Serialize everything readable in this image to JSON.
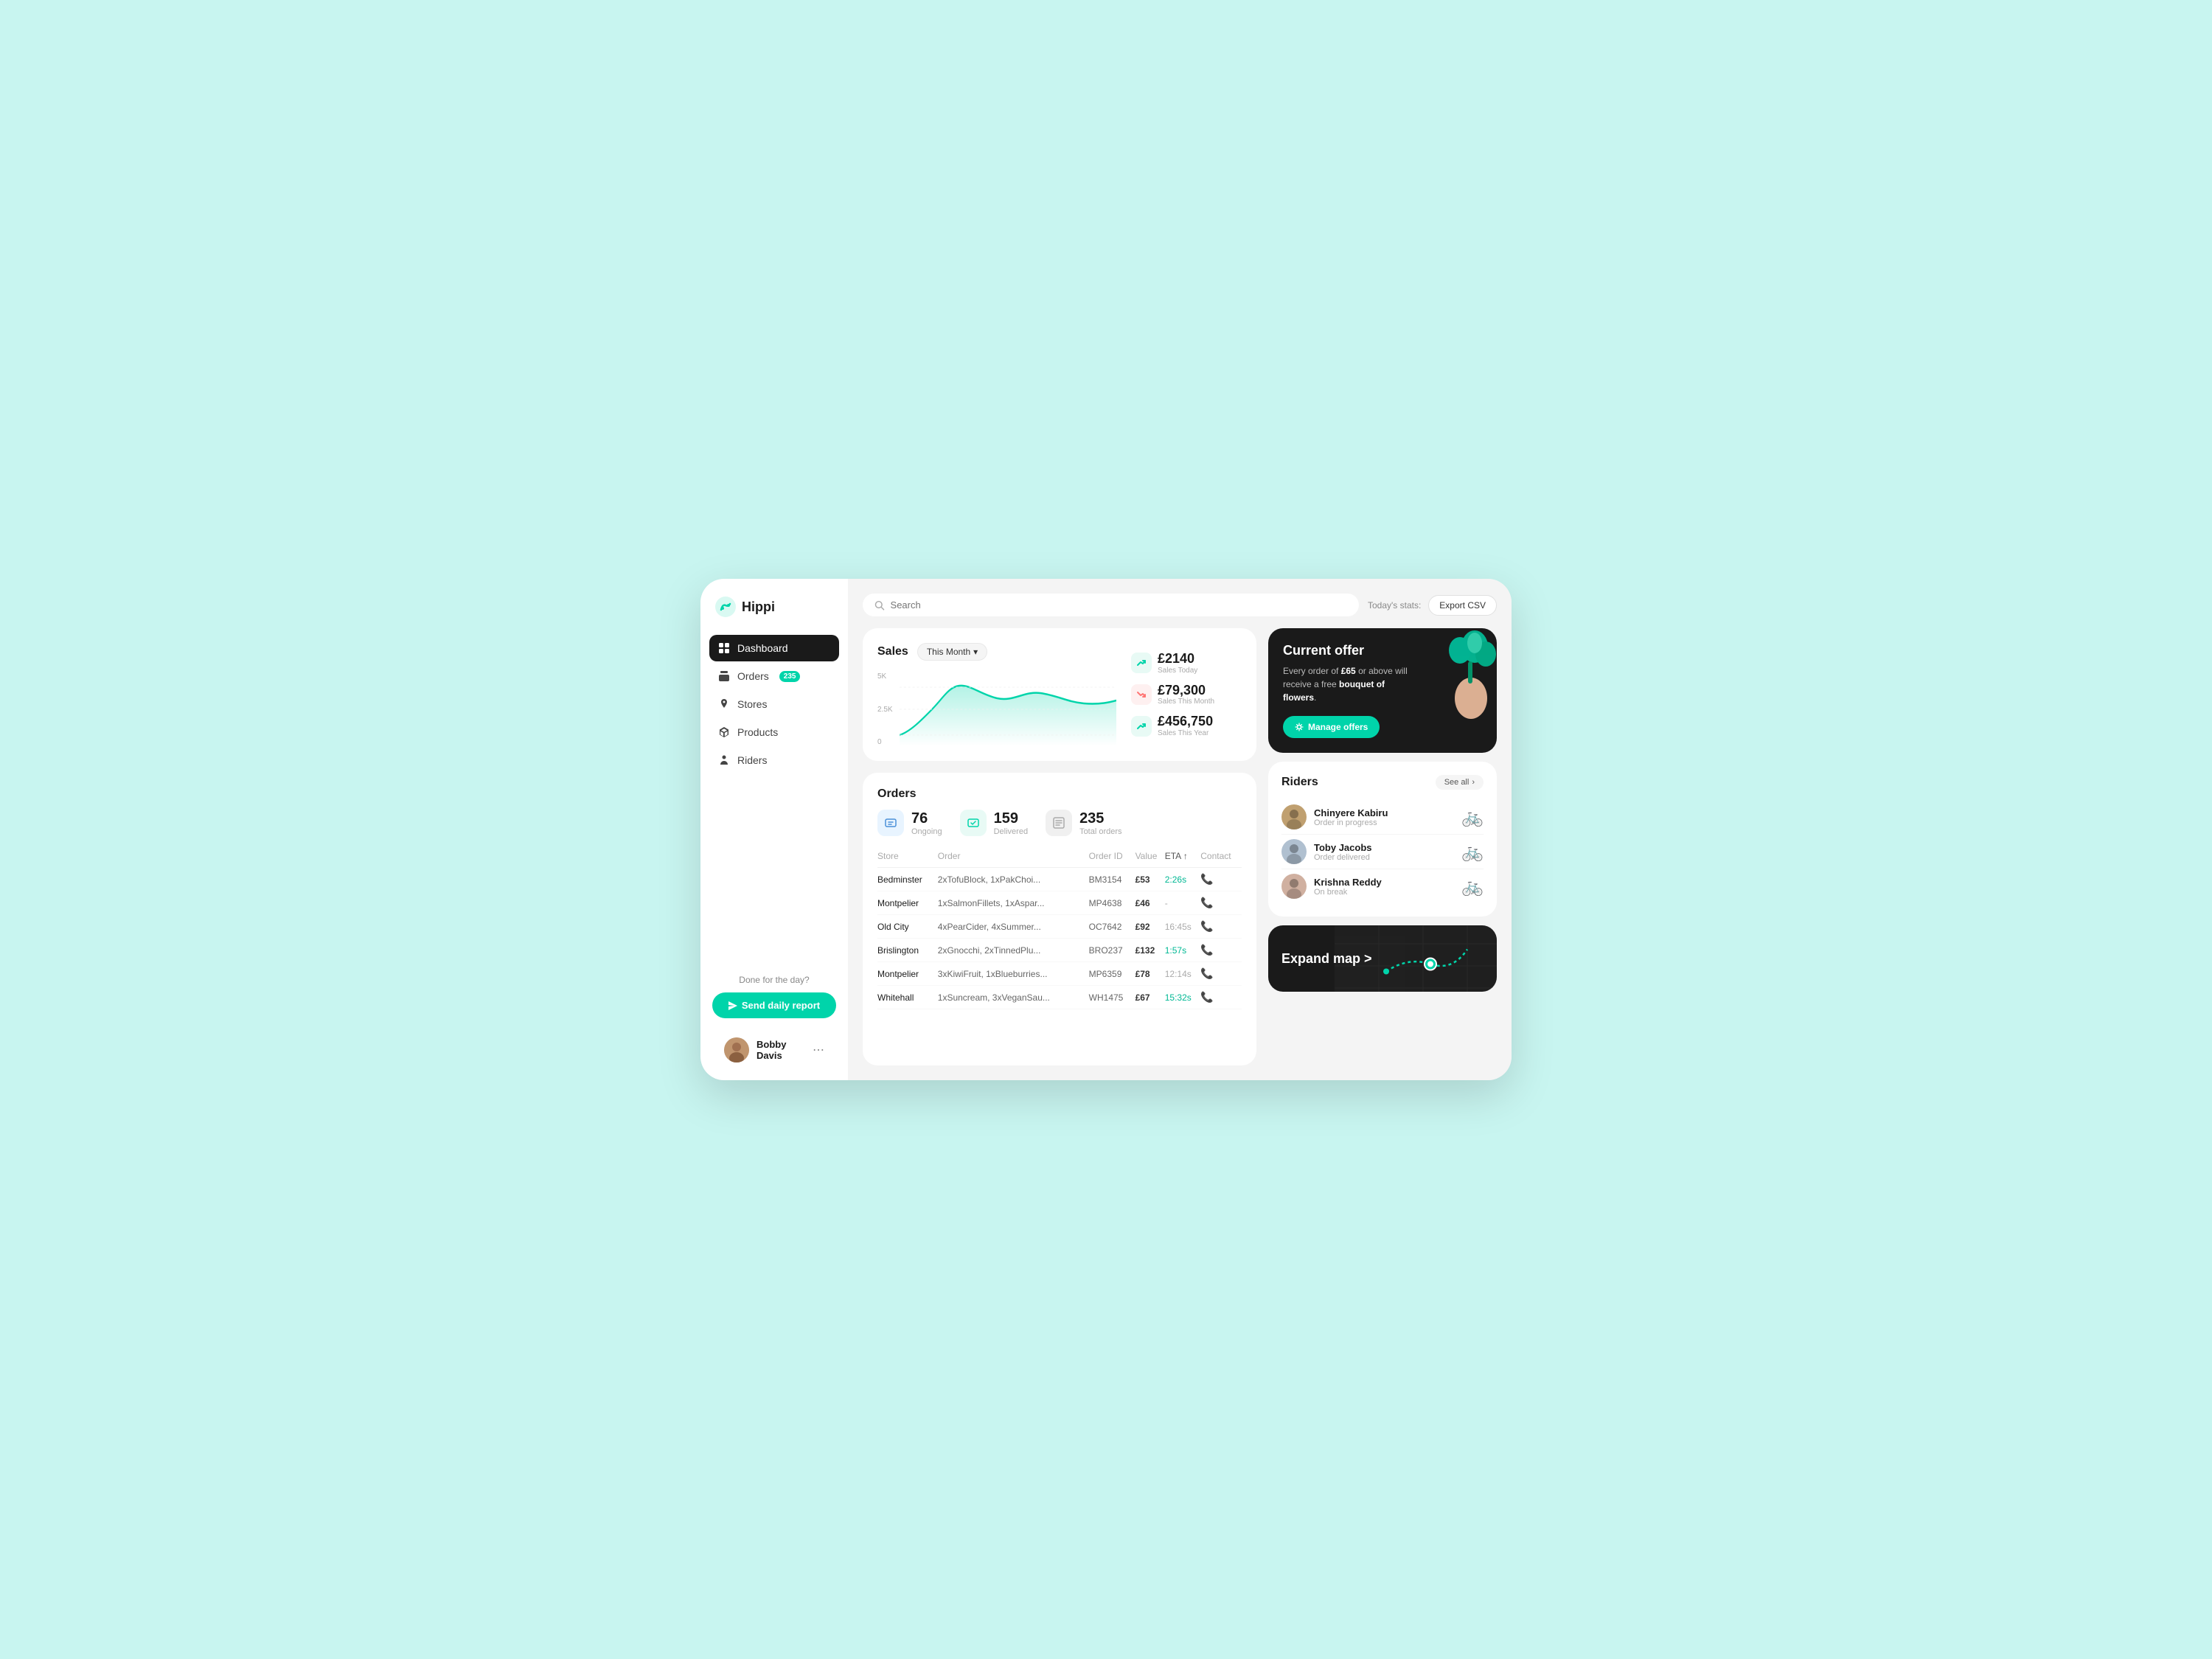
{
  "app": {
    "name": "Hippi"
  },
  "sidebar": {
    "nav_items": [
      {
        "id": "dashboard",
        "label": "Dashboard",
        "icon": "grid",
        "active": true,
        "badge": null
      },
      {
        "id": "orders",
        "label": "Orders",
        "icon": "bag",
        "active": false,
        "badge": "235"
      },
      {
        "id": "stores",
        "label": "Stores",
        "icon": "location",
        "active": false,
        "badge": null
      },
      {
        "id": "products",
        "label": "Products",
        "icon": "leaf",
        "active": false,
        "badge": null
      },
      {
        "id": "riders",
        "label": "Riders",
        "icon": "person",
        "active": false,
        "badge": null
      }
    ],
    "done_text": "Done for the day?",
    "send_report_label": "Send daily report",
    "user": {
      "name": "Bobby Davis"
    }
  },
  "header": {
    "search_placeholder": "Search",
    "stats_label": "Today's stats:",
    "export_btn": "Export CSV"
  },
  "sales": {
    "title": "Sales",
    "period": "This Month",
    "metrics": [
      {
        "value": "£2140",
        "label": "Sales Today",
        "trend": "up"
      },
      {
        "value": "£79,300",
        "label": "Sales This Month",
        "trend": "down"
      },
      {
        "value": "£456,750",
        "label": "Sales This Year",
        "trend": "up"
      }
    ],
    "chart_y_labels": [
      "5K",
      "2.5K",
      "0"
    ],
    "chart_data": [
      10,
      20,
      60,
      80,
      55,
      70,
      45,
      65,
      60,
      55,
      65
    ]
  },
  "orders": {
    "title": "Orders",
    "stats": [
      {
        "num": "76",
        "label": "Ongoing",
        "type": "blue"
      },
      {
        "num": "159",
        "label": "Delivered",
        "type": "green"
      },
      {
        "num": "235",
        "label": "Total orders",
        "type": "gray"
      }
    ],
    "table_headers": [
      "Store",
      "Order",
      "Order ID",
      "Value",
      "ETA",
      "Contact"
    ],
    "rows": [
      {
        "store": "Bedminster",
        "order": "2xTofuBlock, 1xPakChoi...",
        "order_id": "BM3154",
        "value": "£53",
        "eta": "2:26s",
        "eta_type": "active",
        "contact": "active"
      },
      {
        "store": "Montpelier",
        "order": "1xSalmonFillets, 1xAspar...",
        "order_id": "MP4638",
        "value": "£46",
        "eta": "-",
        "eta_type": "dash",
        "contact": "active"
      },
      {
        "store": "Old City",
        "order": "4xPearCider, 4xSummer...",
        "order_id": "OC7642",
        "value": "£92",
        "eta": "16:45s",
        "eta_type": "gray",
        "contact": "gray"
      },
      {
        "store": "Brislington",
        "order": "2xGnocchi, 2xTinnedPlu...",
        "order_id": "BRO237",
        "value": "£132",
        "eta": "1:57s",
        "eta_type": "active",
        "contact": "active"
      },
      {
        "store": "Montpelier",
        "order": "3xKiwiFruit, 1xBlueburries...",
        "order_id": "MP6359",
        "value": "£78",
        "eta": "12:14s",
        "eta_type": "gray",
        "contact": "gray"
      },
      {
        "store": "Whitehall",
        "order": "1xSuncream, 3xVeganSau...",
        "order_id": "WH1475",
        "value": "£67",
        "eta": "15:32s",
        "eta_type": "active",
        "contact": "active"
      }
    ]
  },
  "offer": {
    "title": "Current offer",
    "text_plain": "Every order of ",
    "highlight1": "£65",
    "text_mid": " or above will receive a free ",
    "highlight2": "bouquet of flowers",
    "text_end": ".",
    "manage_label": "Manage offers"
  },
  "riders": {
    "title": "Riders",
    "see_all": "See all",
    "items": [
      {
        "name": "Chinyere Kabiru",
        "status": "Order in progress"
      },
      {
        "name": "Toby Jacobs",
        "status": "Order delivered"
      },
      {
        "name": "Krishna Reddy",
        "status": "On break"
      }
    ]
  },
  "map": {
    "title": "Expand map >"
  }
}
